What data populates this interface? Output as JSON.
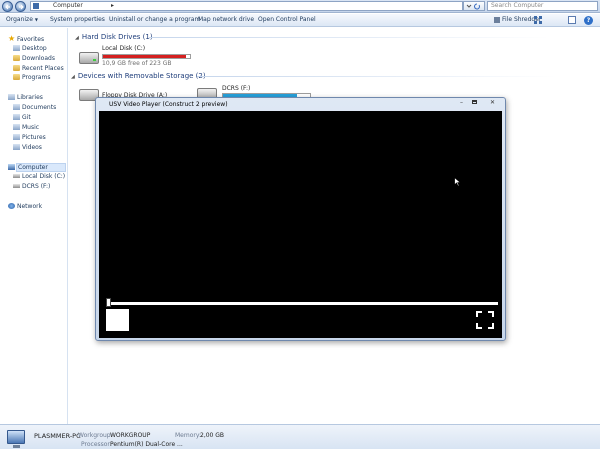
{
  "address_bar": {
    "path_label": "Computer",
    "path_separator": "▸",
    "search_placeholder": "Search Computer",
    "icons": [
      "back-icon",
      "forward-icon",
      "refresh-icon"
    ]
  },
  "toolbar": {
    "organize_label": "Organize",
    "organize_arrow": "▼",
    "system_properties_label": "System properties",
    "uninstall_label": "Uninstall or change a program",
    "map_drive_label": "Map network drive",
    "control_panel_label": "Open Control Panel",
    "file_shredder_label": "File Shredder",
    "help_glyph": "?"
  },
  "nav_pane": {
    "favorites": {
      "label": "Favorites",
      "items": [
        {
          "label": "Desktop"
        },
        {
          "label": "Downloads"
        },
        {
          "label": "Recent Places"
        },
        {
          "label": "Programs"
        }
      ]
    },
    "libraries": {
      "label": "Libraries",
      "items": [
        {
          "label": "Documents"
        },
        {
          "label": "Git"
        },
        {
          "label": "Music"
        },
        {
          "label": "Pictures"
        },
        {
          "label": "Videos"
        }
      ]
    },
    "computer": {
      "label": "Computer",
      "items": [
        {
          "label": "Local Disk (C:)"
        },
        {
          "label": "DCRS (F:)"
        }
      ]
    },
    "network": {
      "label": "Network"
    }
  },
  "content": {
    "hard_disk_group": {
      "label": "Hard Disk Drives (1)",
      "drives": [
        {
          "name": "Local Disk (C:)",
          "free_text": "10,9 GB free of 223 GB",
          "used_fraction": 0.95,
          "bar_color": "#d42020"
        }
      ]
    },
    "removable_group": {
      "label": "Devices with Removable Storage (2)",
      "drives": [
        {
          "name": "Floppy Disk Drive (A:)"
        },
        {
          "name": "DCRS (F:)",
          "used_fraction": 0.85,
          "bar_color": "#26a0da"
        }
      ]
    }
  },
  "details": {
    "computer_name": "PLASMMER-PC",
    "workgroup_label": "Workgroup:",
    "workgroup_value": "WORKGROUP",
    "memory_label": "Memory:",
    "memory_value": "2,00 GB",
    "processor_label": "Processor:",
    "processor_value": "Pentium(R) Dual-Core ..."
  },
  "player_window": {
    "title": "USV Video Player (Construct 2 preview)",
    "minimize_glyph": "–",
    "close_glyph": "✕",
    "seek_progress": 0.0,
    "colors": {
      "background": "#000000",
      "controls": "#ffffff"
    }
  }
}
